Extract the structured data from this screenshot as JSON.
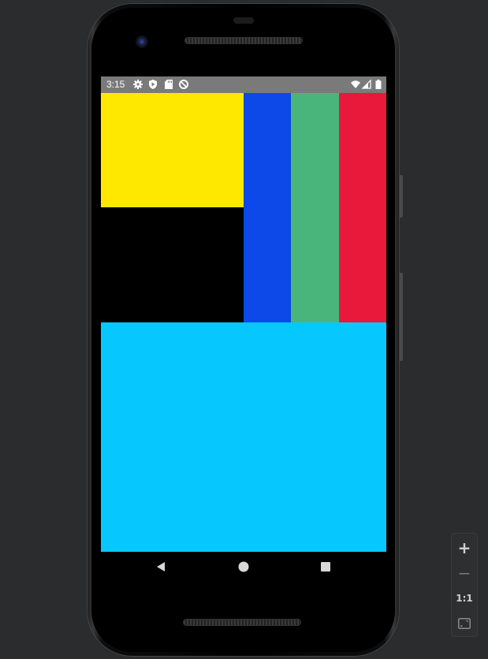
{
  "status_bar": {
    "time": "3:15",
    "background": "#7a7a7a",
    "left_icons": [
      "settings-icon",
      "play-protect-icon",
      "sd-card-icon",
      "data-saver-icon"
    ],
    "right_icons": [
      "wifi-icon",
      "cellular-signal-icon",
      "battery-icon"
    ]
  },
  "app_content": {
    "blocks": [
      {
        "name": "yellow-block",
        "color": "#ffe800"
      },
      {
        "name": "blue-column",
        "color": "#0c49e8"
      },
      {
        "name": "green-column",
        "color": "#4ab57a"
      },
      {
        "name": "red-column",
        "color": "#e8193a"
      },
      {
        "name": "cyan-block",
        "color": "#06c8ff"
      }
    ],
    "background": "#000000"
  },
  "nav_bar": {
    "buttons": [
      "back-icon",
      "home-icon",
      "recents-icon"
    ]
  },
  "zoom_controls": {
    "zoom_in": "+",
    "zoom_out": "−",
    "actual_size": "1:1",
    "fit_icon": "fit-screen-icon"
  }
}
